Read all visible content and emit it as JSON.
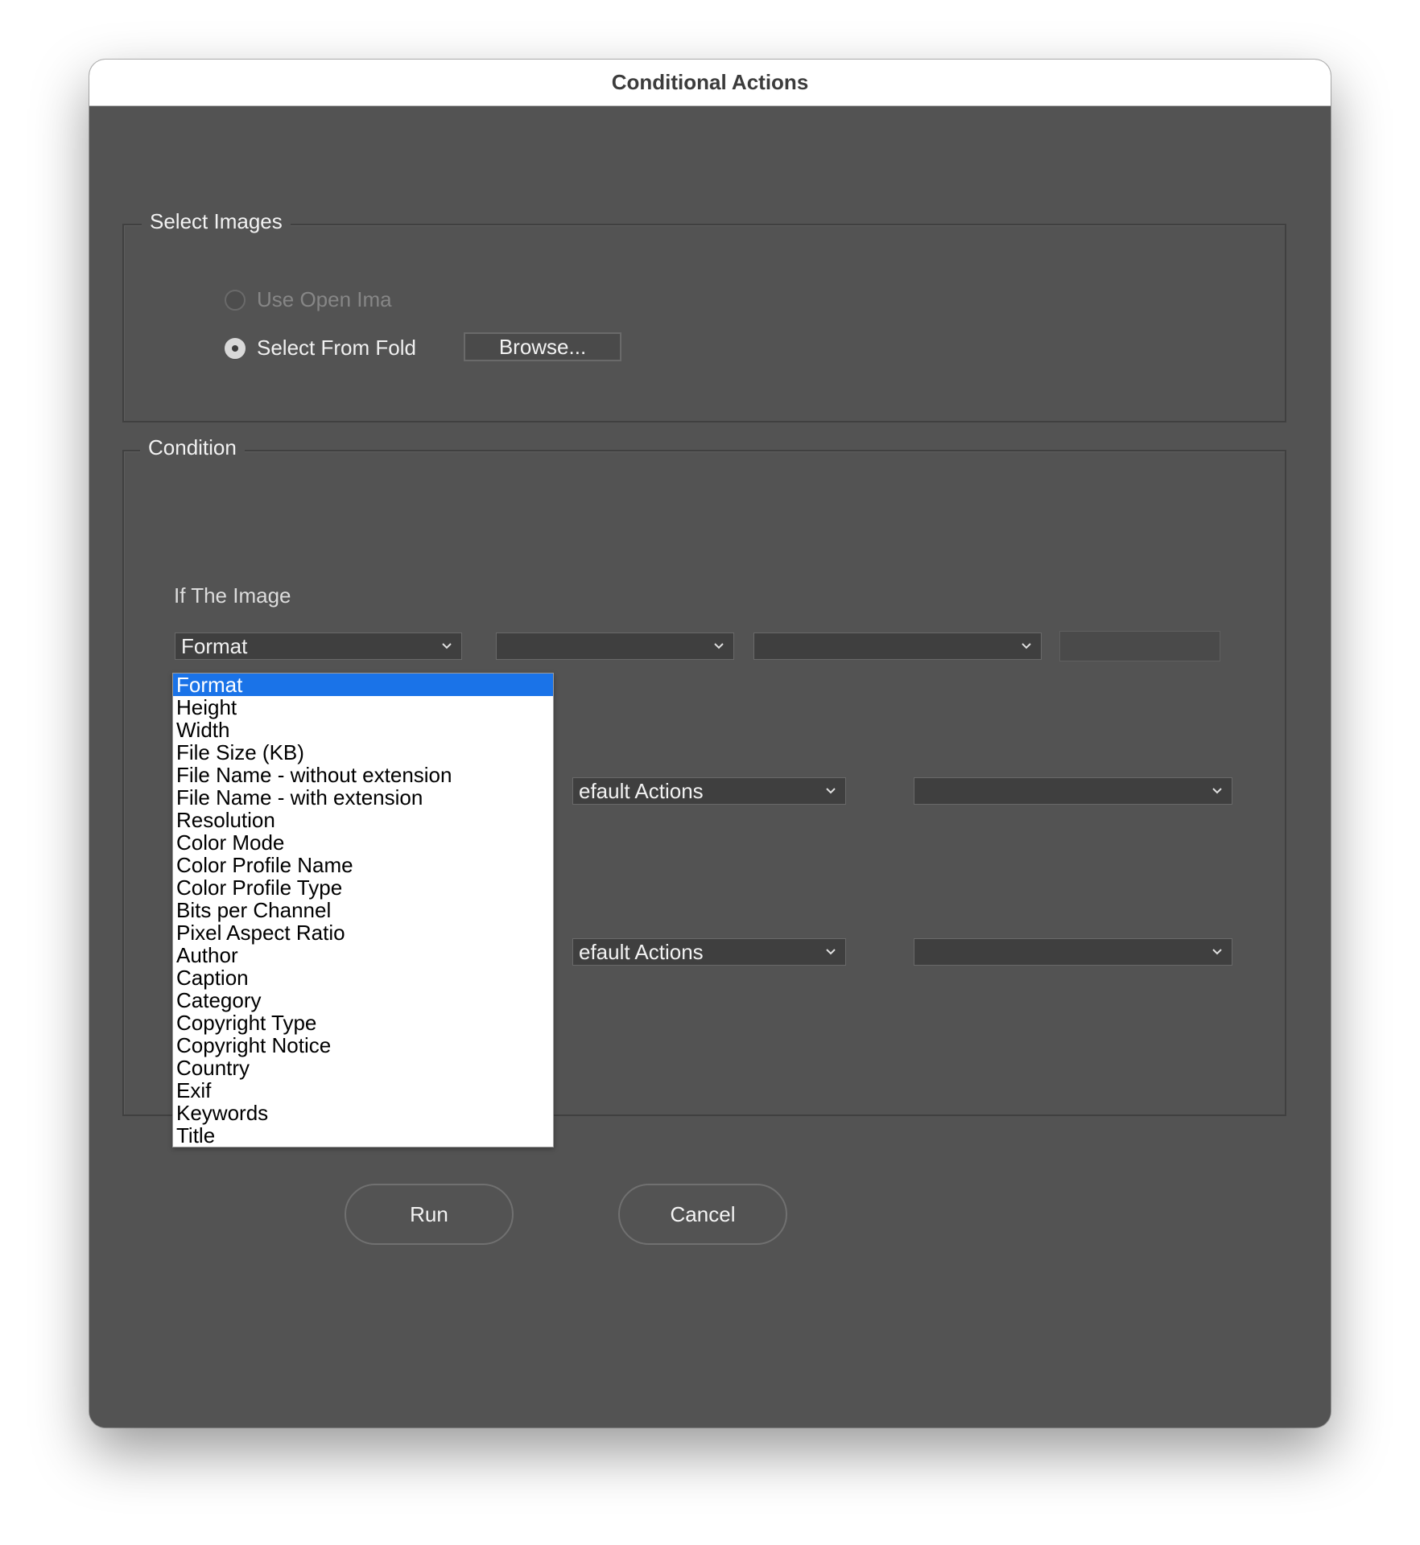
{
  "window": {
    "title": "Conditional Actions"
  },
  "select_images": {
    "title": "Select Images",
    "use_open_images_label": "Use Open Ima",
    "select_from_folder_label": "Select From Fold",
    "browse_label": "Browse..."
  },
  "condition": {
    "title": "Condition",
    "if_label": "If The Image",
    "attribute_value": "Format",
    "operator_value": "",
    "compare_value": "",
    "text_value": "",
    "action1_set": "efault Actions",
    "action1_action": "",
    "action2_set": "efault Actions",
    "action2_action": ""
  },
  "buttons": {
    "run_label": "Run",
    "cancel_label": "Cancel"
  },
  "attribute_menu": {
    "selected": "Format",
    "options": [
      "Format",
      "Height",
      "Width",
      "File Size (KB)",
      "File Name - without extension",
      "File Name - with extension",
      "Resolution",
      "Color Mode",
      "Color Profile Name",
      "Color Profile Type",
      "Bits per Channel",
      "Pixel Aspect Ratio",
      "Author",
      "Caption",
      "Category",
      "Copyright Type",
      "Copyright Notice",
      "Country",
      "Exif",
      "Keywords",
      "Title"
    ]
  },
  "colors": {
    "dialog_bg": "#535353",
    "menu_highlight": "#1a73e8"
  },
  "icons": {
    "dropdown_arrow": "chevron-down-icon"
  }
}
